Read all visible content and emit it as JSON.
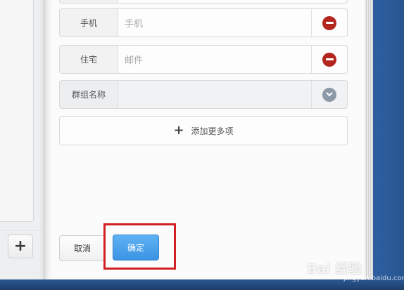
{
  "form": {
    "rows": [
      {
        "label": "手机",
        "placeholder": "手机",
        "action_icon": "remove-icon"
      },
      {
        "label": "住宅",
        "placeholder": "邮件",
        "action_icon": "remove-icon"
      },
      {
        "label": "群组名称",
        "placeholder": "",
        "action_icon": "chevron-down-icon"
      }
    ],
    "add_more_label": "添加更多项"
  },
  "left_panel": {
    "add_icon": "plus-icon",
    "add_glyph": "+"
  },
  "actions": {
    "cancel_label": "取消",
    "confirm_label": "确定"
  },
  "watermark": {
    "brand": "Bai 经验",
    "sub": "jingyan.baidu.com"
  },
  "colors": {
    "confirm": "#3b93e2",
    "remove": "#b3261e",
    "highlight": "#d21f22",
    "frame": "#2b5a98"
  }
}
